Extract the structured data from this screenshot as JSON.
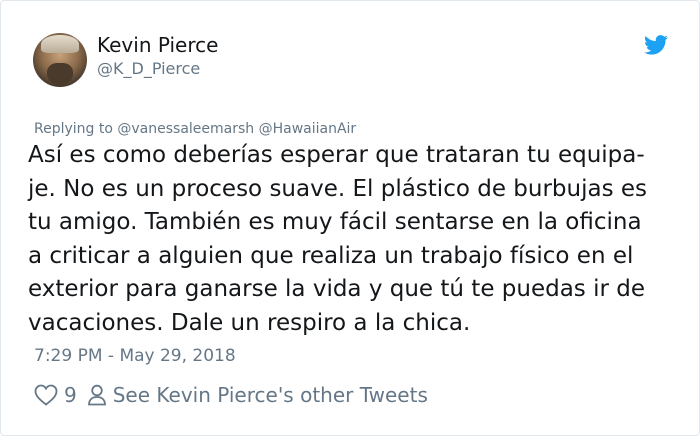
{
  "user": {
    "name": "Kevin Pierce",
    "handle": "@K_D_Pierce"
  },
  "tweet": {
    "replying_to": "Replying to @vanessaleemarsh @HawaiianAir",
    "lines": [
      "Así es como deberías esperar que trataran tu equipa-",
      "je. No es un proceso suave. El plástico de burbujas es",
      "tu amigo. También es muy fácil sentarse en la oficina",
      "a criticar a alguien que realiza un trabajo físico en el",
      "exterior para ganarse la vida y que tú te puedas ir de",
      "vacaciones. Dale un respiro a la chica."
    ],
    "timestamp": "7:29 PM - May 29, 2018"
  },
  "actions": {
    "like_count": "9",
    "other_tweets_label": "See Kevin Pierce's other Tweets"
  },
  "icons": {
    "bird": "twitter-bird-icon",
    "heart": "heart-outline-icon",
    "person": "person-outline-icon"
  },
  "colors": {
    "twitter_blue": "#1da1f2",
    "text": "#14171a",
    "muted": "#657786",
    "border": "#e1e8ed"
  }
}
